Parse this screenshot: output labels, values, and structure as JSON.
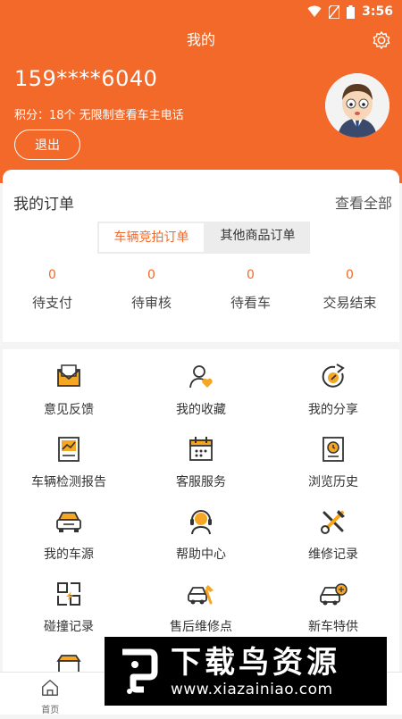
{
  "status": {
    "time": "3:56"
  },
  "header": {
    "title": "我的"
  },
  "profile": {
    "phone": "159****6040",
    "points_text": "积分：18个 无限制查看车主电话",
    "logout_label": "退出"
  },
  "orders": {
    "title": "我的订单",
    "view_all": "查看全部",
    "tabs": [
      {
        "label": "车辆竞拍订单"
      },
      {
        "label": "其他商品订单"
      }
    ],
    "stats": [
      {
        "count": "0",
        "label": "待支付"
      },
      {
        "count": "0",
        "label": "待审核"
      },
      {
        "count": "0",
        "label": "待看车"
      },
      {
        "count": "0",
        "label": "交易结束"
      }
    ]
  },
  "menu": [
    {
      "label": "意见反馈",
      "icon": "feedback-icon"
    },
    {
      "label": "我的收藏",
      "icon": "favorite-icon"
    },
    {
      "label": "我的分享",
      "icon": "share-icon"
    },
    {
      "label": "车辆检测报告",
      "icon": "report-icon"
    },
    {
      "label": "客服服务",
      "icon": "calendar-icon"
    },
    {
      "label": "浏览历史",
      "icon": "history-icon"
    },
    {
      "label": "我的车源",
      "icon": "car-source-icon"
    },
    {
      "label": "帮助中心",
      "icon": "headset-icon"
    },
    {
      "label": "维修记录",
      "icon": "tools-icon"
    },
    {
      "label": "碰撞记录",
      "icon": "collision-icon"
    },
    {
      "label": "售后维修点",
      "icon": "repair-car-icon"
    },
    {
      "label": "新车特供",
      "icon": "new-car-icon"
    }
  ],
  "tabbar": [
    {
      "label": "首页",
      "icon": "home-icon"
    }
  ],
  "watermark": {
    "title": "下载鸟资源",
    "url": "www.xiazainiao.com"
  },
  "colors": {
    "accent": "#f2692a",
    "icon_yellow": "#f5a623"
  }
}
